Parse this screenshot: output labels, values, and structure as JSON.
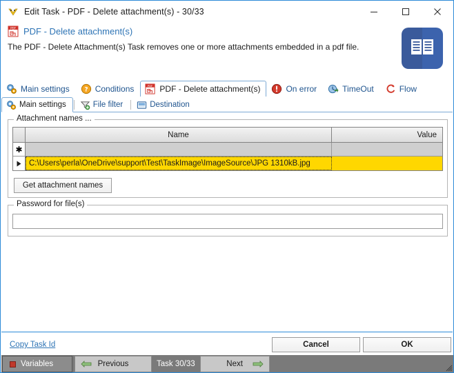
{
  "window": {
    "title": "Edit Task - PDF - Delete attachment(s) - 30/33",
    "icon": "app-icon",
    "minimize_label": "—",
    "maximize_label": "□",
    "close_label": "✕",
    "accent_color": "#2b8ad8"
  },
  "header": {
    "title": "PDF - Delete attachment(s)",
    "description": "The PDF - Delete Attachment(s) Task removes one or more attachments embedded in a pdf file.",
    "title_color": "#2e74b5",
    "logo_color": "#3a5a9b",
    "logo_icon": "open-book-icon"
  },
  "tabs": [
    {
      "label": "Main settings",
      "icon": "gears-icon",
      "active": false
    },
    {
      "label": "Conditions",
      "icon": "question-mark-icon",
      "active": false
    },
    {
      "label": "PDF - Delete attachment(s)",
      "icon": "pdf-icon",
      "active": true
    },
    {
      "label": "On error",
      "icon": "error-exclamation-icon",
      "active": false
    },
    {
      "label": "TimeOut",
      "icon": "timeout-icon",
      "active": false
    },
    {
      "label": "Flow",
      "icon": "flow-icon",
      "active": false
    }
  ],
  "subtabs": [
    {
      "label": "Main settings",
      "icon": "gears-icon",
      "active": true
    },
    {
      "label": "File filter",
      "icon": "funnel-add-icon",
      "active": false
    },
    {
      "label": "Destination",
      "icon": "monitor-icon",
      "active": false
    }
  ],
  "attachments_group": {
    "legend": "Attachment names ...",
    "columns": [
      "Name",
      "Value"
    ],
    "new_row_marker": "✱",
    "current_row_marker": "▶",
    "rows": [
      {
        "name": "C:\\Users\\perla\\OneDrive\\support\\Test\\TaskImage\\ImageSource\\JPG 1310kB.jpg",
        "value": "",
        "selected": true,
        "highlight_color": "#ffd700"
      }
    ],
    "get_attachment_names_label": "Get attachment names"
  },
  "password_group": {
    "legend": "Password for file(s)",
    "value": "",
    "placeholder": ""
  },
  "footer": {
    "copy_task_id_label": "Copy Task Id",
    "cancel_label": "Cancel",
    "ok_label": "OK"
  },
  "statusbar": {
    "variables_label": "Variables",
    "previous_label": "Previous",
    "task_counter": "Task 30/33",
    "next_label": "Next",
    "variables_dot_color": "#c0392b",
    "arrow_color": "#6aaa4f"
  }
}
